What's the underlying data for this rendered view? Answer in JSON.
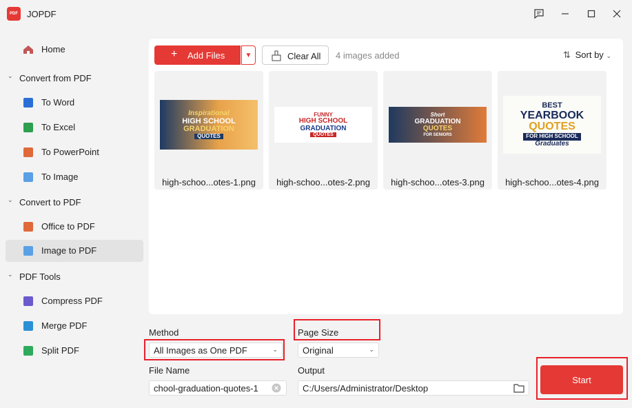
{
  "app": {
    "title": "JOPDF",
    "logo_text": "PDF"
  },
  "window_controls": [
    "chat-icon",
    "minimize-icon",
    "maximize-icon",
    "close-icon"
  ],
  "sidebar": {
    "home": "Home",
    "sections": [
      {
        "label": "Convert from PDF",
        "items": [
          "To Word",
          "To Excel",
          "To PowerPoint",
          "To Image"
        ]
      },
      {
        "label": "Convert to PDF",
        "items": [
          "Office to PDF",
          "Image to PDF"
        ]
      },
      {
        "label": "PDF Tools",
        "items": [
          "Compress PDF",
          "Merge PDF",
          "Split PDF"
        ]
      }
    ],
    "active_item": "Image to PDF"
  },
  "toolbar": {
    "add_files": "Add Files",
    "clear_all": "Clear All",
    "count_text": "4 images added",
    "sort_by": "Sort by"
  },
  "files": [
    {
      "name": "high-schoo...otes-1.png",
      "thumb_lines": [
        "Inspirational",
        "HIGH SCHOOL",
        "GRADUATION",
        "QUOTES"
      ]
    },
    {
      "name": "high-schoo...otes-2.png",
      "thumb_lines": [
        "FUNNY",
        "HIGH SCHOOL",
        "GRADUATION",
        "QUOTES"
      ]
    },
    {
      "name": "high-schoo...otes-3.png",
      "thumb_lines": [
        "Short",
        "GRADUATION",
        "QUOTES",
        "FOR SENIORS"
      ]
    },
    {
      "name": "high-schoo...otes-4.png",
      "thumb_lines": [
        "BEST",
        "YEARBOOK",
        "QUOTES",
        "FOR HIGH SCHOOL",
        "Graduates"
      ]
    }
  ],
  "form": {
    "method_label": "Method",
    "method_value": "All Images as One PDF",
    "page_size_label": "Page Size",
    "page_size_value": "Original",
    "file_name_label": "File Name",
    "file_name_value": "chool-graduation-quotes-1",
    "output_label": "Output",
    "output_value": "C:/Users/Administrator/Desktop",
    "start": "Start"
  },
  "colors": {
    "accent": "#e53935",
    "highlight": "#e8202a"
  }
}
